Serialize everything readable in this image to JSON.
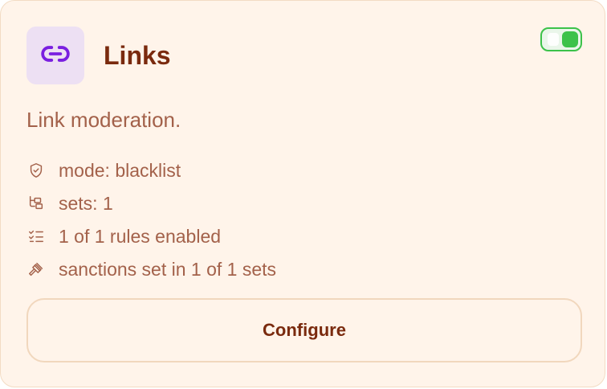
{
  "card": {
    "title": "Links",
    "icon": "link-icon",
    "description": "Link moderation.",
    "enabled": true,
    "stats": [
      {
        "icon": "shield-check-icon",
        "label": "mode: blacklist"
      },
      {
        "icon": "folder-tree-icon",
        "label": "sets: 1"
      },
      {
        "icon": "list-checks-icon",
        "label": "1 of 1 rules enabled"
      },
      {
        "icon": "gavel-icon",
        "label": "sanctions set in 1 of 1 sets"
      }
    ],
    "configure_label": "Configure"
  },
  "colors": {
    "card_background": "#fff4ea",
    "card_border": "#f3dcc4",
    "icon_tile": "#ede0f3",
    "icon_accent": "#7a1fe0",
    "title": "#7a2a0e",
    "text_muted": "#a3614a",
    "toggle_on": "#3cc24a"
  }
}
